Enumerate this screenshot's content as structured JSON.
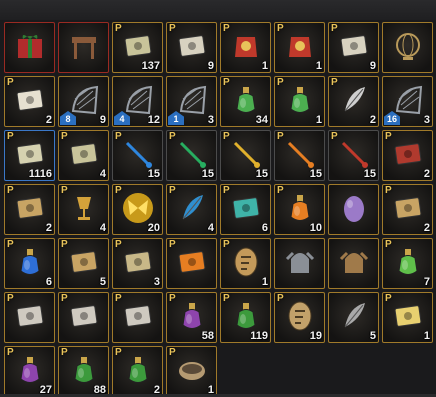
{
  "slots": [
    {
      "name": "gift-box-icon",
      "frame": "red",
      "p": false,
      "count": "",
      "lvl": "",
      "color": "#b22c2c"
    },
    {
      "name": "wooden-table-icon",
      "frame": "red",
      "p": false,
      "count": "",
      "lvl": "",
      "color": "#8a5a3a"
    },
    {
      "name": "green-scroll-icon",
      "frame": "gold",
      "p": true,
      "count": "137",
      "lvl": "",
      "color": "#c9c49a"
    },
    {
      "name": "map-scroll-icon",
      "frame": "gold",
      "p": true,
      "count": "9",
      "lvl": "",
      "color": "#d8d2c0"
    },
    {
      "name": "red-armor-icon",
      "frame": "gold",
      "p": true,
      "count": "1",
      "lvl": "",
      "color": "#c0392b"
    },
    {
      "name": "red-armor-icon",
      "frame": "gold",
      "p": true,
      "count": "1",
      "lvl": "",
      "color": "#c0392b"
    },
    {
      "name": "map-scroll-icon",
      "frame": "gold",
      "p": true,
      "count": "9",
      "lvl": "",
      "color": "#d8d2c0"
    },
    {
      "name": "globe-icon",
      "frame": "gold",
      "p": false,
      "count": "",
      "lvl": "",
      "color": "#b99a5a"
    },
    {
      "name": "document-icon",
      "frame": "gold",
      "p": true,
      "count": "2",
      "lvl": "",
      "color": "#e6e0d0"
    },
    {
      "name": "fishing-net-icon",
      "frame": "gold",
      "p": false,
      "count": "9",
      "lvl": "8",
      "color": "#9aa0a8"
    },
    {
      "name": "fishing-net-icon",
      "frame": "gold",
      "p": false,
      "count": "12",
      "lvl": "4",
      "color": "#9aa0a8"
    },
    {
      "name": "fishing-net-icon",
      "frame": "gold",
      "p": false,
      "count": "3",
      "lvl": "1",
      "color": "#9aa0a8"
    },
    {
      "name": "green-potion-icon",
      "frame": "gold",
      "p": true,
      "count": "34",
      "lvl": "",
      "color": "#4caf50"
    },
    {
      "name": "green-potion-icon",
      "frame": "gold",
      "p": true,
      "count": "1",
      "lvl": "",
      "color": "#4caf50"
    },
    {
      "name": "coral-icon",
      "frame": "gold",
      "p": true,
      "count": "2",
      "lvl": "",
      "color": "#cfcfcf"
    },
    {
      "name": "fishing-net-icon",
      "frame": "gold",
      "p": false,
      "count": "3",
      "lvl": "16",
      "color": "#9aa0a8"
    },
    {
      "name": "green-scroll-icon",
      "frame": "blue",
      "p": true,
      "count": "1116",
      "lvl": "",
      "color": "#d6d2b0"
    },
    {
      "name": "green-scroll-icon",
      "frame": "gold",
      "p": true,
      "count": "4",
      "lvl": "",
      "color": "#c9c49a"
    },
    {
      "name": "fishing-rod-icon",
      "frame": "gray",
      "p": true,
      "count": "15",
      "lvl": "",
      "color": "#2e86de"
    },
    {
      "name": "fishing-rod-icon",
      "frame": "gray",
      "p": true,
      "count": "15",
      "lvl": "",
      "color": "#27ae60"
    },
    {
      "name": "fishing-rod-icon",
      "frame": "gray",
      "p": true,
      "count": "15",
      "lvl": "",
      "color": "#e1b12c"
    },
    {
      "name": "fishing-rod-icon",
      "frame": "gray",
      "p": true,
      "count": "15",
      "lvl": "",
      "color": "#e67e22"
    },
    {
      "name": "fishing-rod-icon",
      "frame": "gray",
      "p": true,
      "count": "15",
      "lvl": "",
      "color": "#c0392b"
    },
    {
      "name": "red-card-icon",
      "frame": "gold",
      "p": true,
      "count": "2",
      "lvl": "",
      "color": "#b03a2e"
    },
    {
      "name": "ticket-icon",
      "frame": "gold",
      "p": true,
      "count": "2",
      "lvl": "",
      "color": "#c8a464"
    },
    {
      "name": "golden-chalice-icon",
      "frame": "gold",
      "p": true,
      "count": "4",
      "lvl": "",
      "color": "#d4a23a"
    },
    {
      "name": "butterfly-icon",
      "frame": "gold",
      "p": true,
      "count": "20",
      "lvl": "",
      "color": "#f1c40f"
    },
    {
      "name": "feather-lure-icon",
      "frame": "gold",
      "p": true,
      "count": "4",
      "lvl": "",
      "color": "#2f8fd0"
    },
    {
      "name": "card-icon",
      "frame": "gold",
      "p": true,
      "count": "6",
      "lvl": "",
      "color": "#3fb3a8"
    },
    {
      "name": "orange-flask-icon",
      "frame": "gold",
      "p": true,
      "count": "10",
      "lvl": "",
      "color": "#e67e22"
    },
    {
      "name": "purple-egg-icon",
      "frame": "gold",
      "p": false,
      "count": "",
      "lvl": "",
      "color": "#9b7ac8"
    },
    {
      "name": "ticket-icon",
      "frame": "gold",
      "p": true,
      "count": "2",
      "lvl": "",
      "color": "#c8a464"
    },
    {
      "name": "blue-potion-icon",
      "frame": "gold",
      "p": true,
      "count": "6",
      "lvl": "",
      "color": "#2e6fd8"
    },
    {
      "name": "ticket-icon",
      "frame": "gold",
      "p": true,
      "count": "5",
      "lvl": "",
      "color": "#c8a464"
    },
    {
      "name": "paw-coupon-icon",
      "frame": "gold",
      "p": true,
      "count": "3",
      "lvl": "",
      "color": "#c8b888"
    },
    {
      "name": "orange-card-icon",
      "frame": "gold",
      "p": true,
      "count": "",
      "lvl": "",
      "color": "#e67e22"
    },
    {
      "name": "wooden-tablet-icon",
      "frame": "gold",
      "p": true,
      "count": "1",
      "lvl": "",
      "color": "#c49a5a"
    },
    {
      "name": "gargoyle-statue-icon",
      "frame": "gold",
      "p": false,
      "count": "",
      "lvl": "",
      "color": "#8a8f96"
    },
    {
      "name": "gargoyle-statue-icon",
      "frame": "gold",
      "p": false,
      "count": "",
      "lvl": "",
      "color": "#a07a4a"
    },
    {
      "name": "green-potion-icon",
      "frame": "gold",
      "p": true,
      "count": "7",
      "lvl": "",
      "color": "#5fbf4a"
    },
    {
      "name": "painting-icon",
      "frame": "gold",
      "p": true,
      "count": "",
      "lvl": "",
      "color": "#cfcac0"
    },
    {
      "name": "painting-icon",
      "frame": "gold",
      "p": true,
      "count": "",
      "lvl": "",
      "color": "#cfcac0"
    },
    {
      "name": "painting-icon",
      "frame": "gold",
      "p": true,
      "count": "",
      "lvl": "",
      "color": "#cfcac0"
    },
    {
      "name": "purple-elixir-icon",
      "frame": "gold",
      "p": true,
      "count": "58",
      "lvl": "",
      "color": "#8e44ad"
    },
    {
      "name": "green-elixir-icon",
      "frame": "gold",
      "p": true,
      "count": "119",
      "lvl": "",
      "color": "#3c9a3c"
    },
    {
      "name": "stone-tablet-icon",
      "frame": "gold",
      "p": true,
      "count": "19",
      "lvl": "",
      "color": "#c2a16a"
    },
    {
      "name": "feather-icon",
      "frame": "gold",
      "p": false,
      "count": "5",
      "lvl": "",
      "color": "#a9a9a9"
    },
    {
      "name": "green-ticket-icon",
      "frame": "gold",
      "p": true,
      "count": "1",
      "lvl": "",
      "color": "#e8d070"
    },
    {
      "name": "purple-elixir-icon",
      "frame": "gold",
      "p": true,
      "count": "27",
      "lvl": "",
      "color": "#8e44ad"
    },
    {
      "name": "green-elixir-icon",
      "frame": "gold",
      "p": true,
      "count": "88",
      "lvl": "",
      "color": "#3c9a3c"
    },
    {
      "name": "green-elixir-icon",
      "frame": "gold",
      "p": true,
      "count": "2",
      "lvl": "",
      "color": "#3c9a3c"
    },
    {
      "name": "bowl-icon",
      "frame": "gold",
      "p": true,
      "count": "1",
      "lvl": "",
      "color": "#b59a72"
    }
  ]
}
